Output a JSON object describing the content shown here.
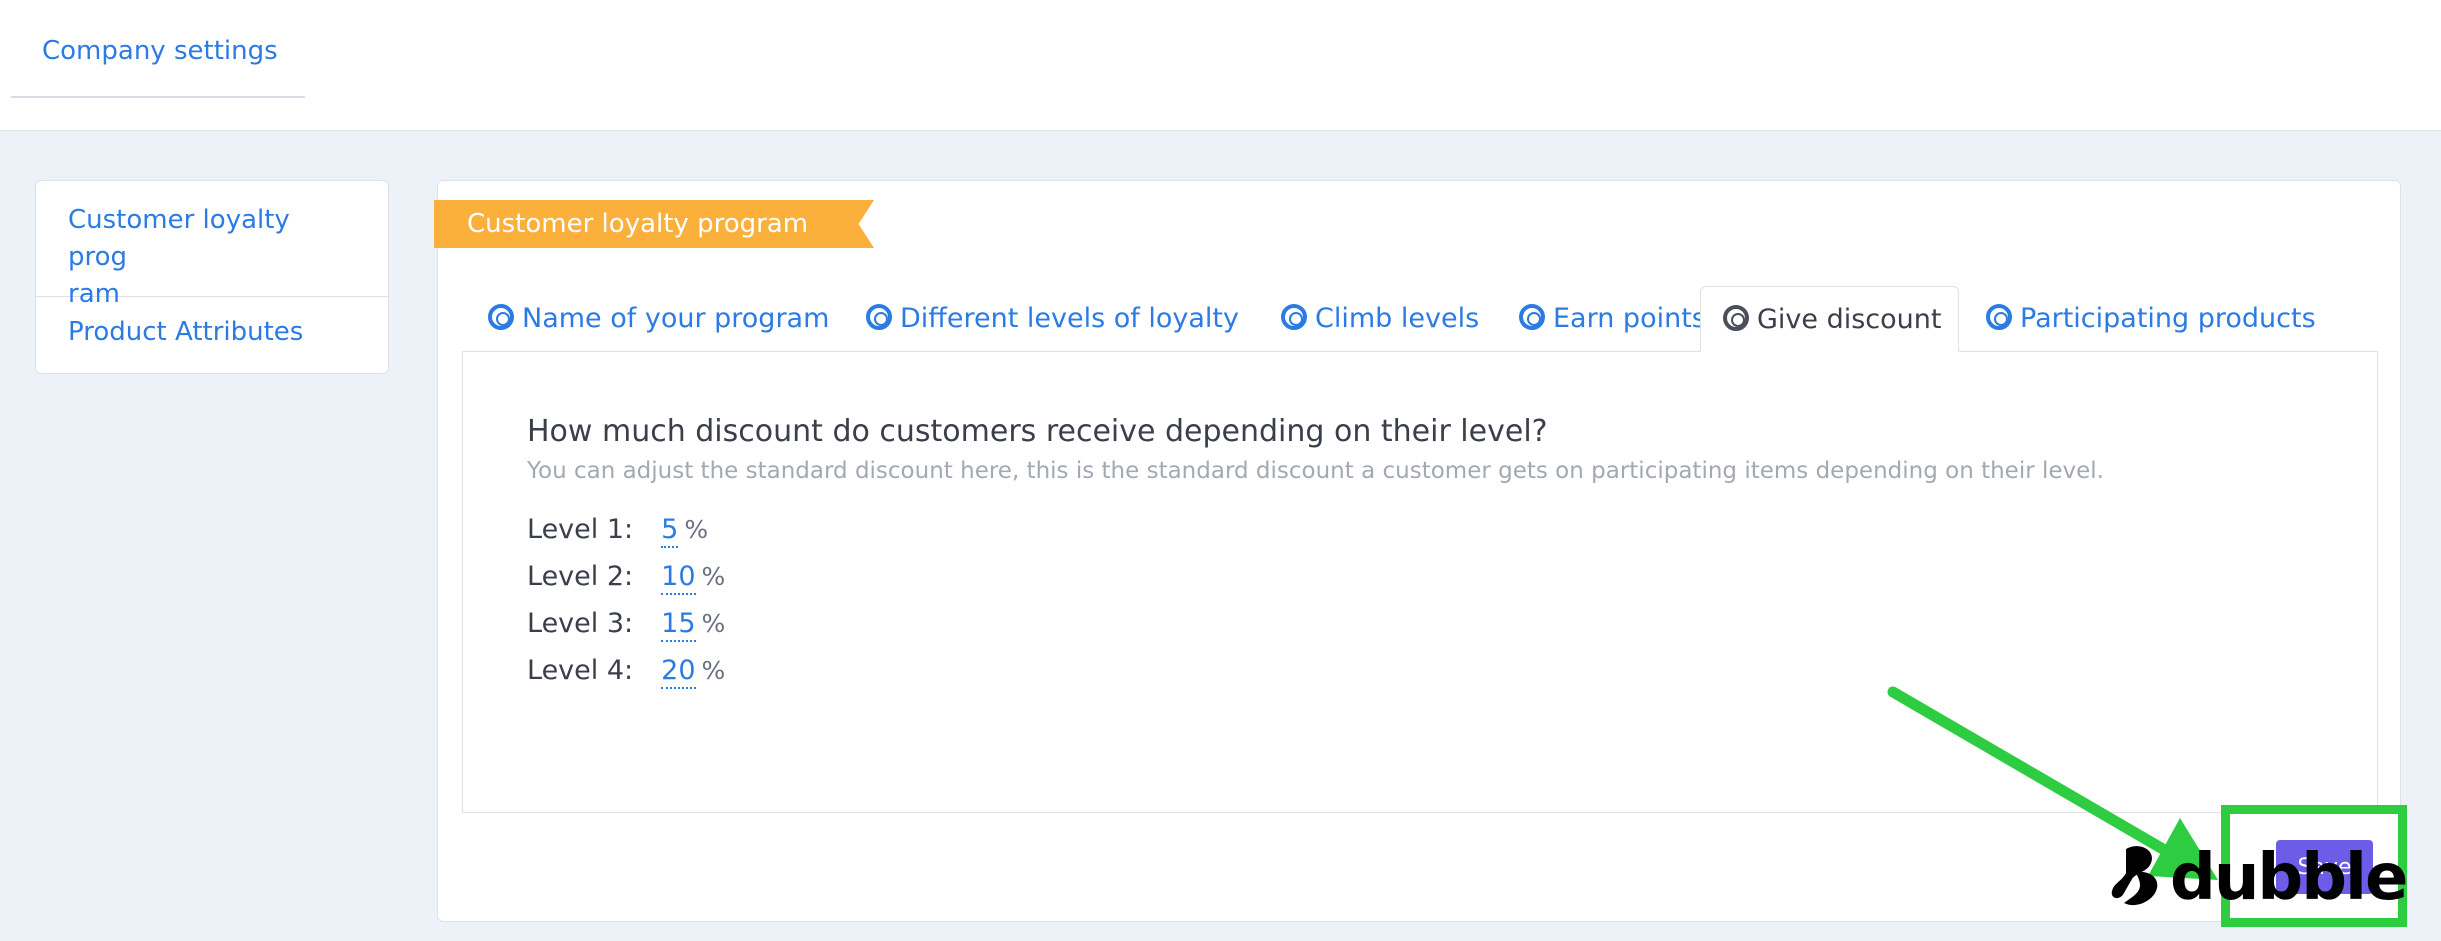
{
  "header": {
    "breadcrumb": "Company settings"
  },
  "sidebar": {
    "items": [
      {
        "label": "Customer loyalty program",
        "line1": "Customer loyalty prog",
        "line2": "ram"
      },
      {
        "label": "Product Attributes"
      }
    ]
  },
  "main": {
    "ribbon_title": "Customer loyalty program",
    "tabs": [
      {
        "label": "Name of your program",
        "icon": "lifebuoy-icon",
        "active": false
      },
      {
        "label": "Different levels of loyalty",
        "icon": "lifebuoy-icon",
        "active": false
      },
      {
        "label": "Climb levels",
        "icon": "lifebuoy-icon",
        "active": false
      },
      {
        "label": "Earn points",
        "icon": "lifebuoy-icon",
        "active": false
      },
      {
        "label": "Give discount",
        "icon": "lifebuoy-icon",
        "active": true
      },
      {
        "label": "Participating products",
        "icon": "lifebuoy-icon",
        "active": false
      }
    ],
    "panel": {
      "title": "How much discount do customers receive depending on their level?",
      "subtitle": "You can adjust the standard discount here, this is the standard discount a customer gets on participating items depending on their level.",
      "levels": [
        {
          "label": "Level 1:",
          "value": "5",
          "unit": "%"
        },
        {
          "label": "Level 2:",
          "value": "10",
          "unit": "%"
        },
        {
          "label": "Level 3:",
          "value": "15",
          "unit": "%"
        },
        {
          "label": "Level 4:",
          "value": "20",
          "unit": "%"
        }
      ]
    },
    "save_label": "Save"
  },
  "overlay": {
    "brand": "dubble",
    "highlight_color": "#2ecc40"
  },
  "colors": {
    "accent": "#2c7be5",
    "ribbon": "#fbb03b",
    "save_button": "#6c5ce7",
    "background": "#edf2f9"
  }
}
